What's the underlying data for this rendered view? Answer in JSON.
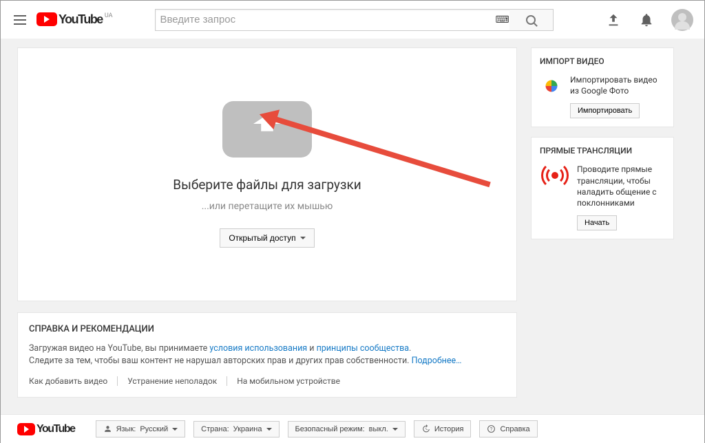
{
  "header": {
    "logo_text": "YouTube",
    "region": "UA",
    "search_placeholder": "Введите запрос"
  },
  "upload": {
    "title": "Выберите файлы для загрузки",
    "subtitle": "...или перетащите их мышью",
    "visibility_label": "Открытый доступ"
  },
  "sidebar": {
    "import": {
      "title": "ИМПОРТ ВИДЕО",
      "text": "Импортировать видео из Google Фото",
      "button": "Импортировать"
    },
    "live": {
      "title": "ПРЯМЫЕ ТРАНСЛЯЦИИ",
      "text": "Проводите прямые трансляции, чтобы наладить общение с поклонниками",
      "button": "Начать"
    }
  },
  "help": {
    "title": "СПРАВКА И РЕКОМЕНДАЦИИ",
    "line1_prefix": "Загружая видео на YouTube, вы принимаете ",
    "tos": "условия использования",
    "and": " и ",
    "guidelines": "принципы сообщества",
    "period": ".",
    "line2_prefix": "Следите за тем, чтобы ваш контент не нарушал авторских прав и других прав собственности. ",
    "more": "Подробнее…",
    "links": [
      "Как добавить видео",
      "Устранение неполадок",
      "На мобильном устройстве"
    ]
  },
  "footer": {
    "logo_text": "YouTube",
    "lang_label": "Язык: ",
    "lang_value": "Русский",
    "country_label": "Страна: ",
    "country_value": "Украина",
    "safe_label": "Безопасный режим: ",
    "safe_value": "выкл.",
    "history": "История",
    "help": "Справка"
  }
}
